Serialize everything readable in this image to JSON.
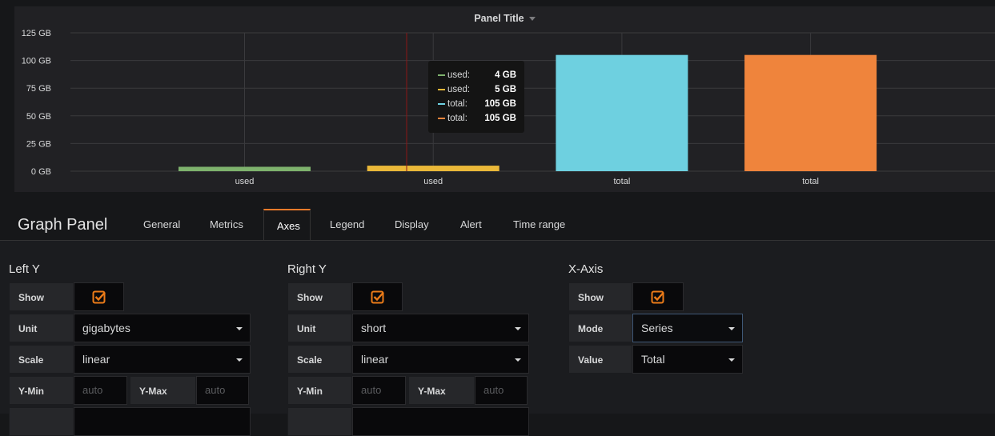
{
  "panel": {
    "title": "Panel Title"
  },
  "chart_data": {
    "type": "bar",
    "y_ticks": [
      "125 GB",
      "100 GB",
      "75 GB",
      "50 GB",
      "25 GB",
      "0 GB"
    ],
    "ylim": [
      0,
      125
    ],
    "categories": [
      "used",
      "used",
      "total",
      "total"
    ],
    "values": [
      4,
      5,
      105,
      105
    ],
    "colors": [
      "#7eb26d",
      "#eab839",
      "#6ed0e0",
      "#ef843c"
    ],
    "grid": true
  },
  "tooltip": {
    "rows": [
      {
        "name": "used:",
        "value": "4 GB",
        "color": "#7eb26d"
      },
      {
        "name": "used:",
        "value": "5 GB",
        "color": "#eab839"
      },
      {
        "name": "total:",
        "value": "105 GB",
        "color": "#6ed0e0"
      },
      {
        "name": "total:",
        "value": "105 GB",
        "color": "#ef843c"
      }
    ]
  },
  "editor": {
    "title": "Graph Panel",
    "tabs": [
      "General",
      "Metrics",
      "Axes",
      "Legend",
      "Display",
      "Alert",
      "Time range"
    ],
    "active_tab": "Axes"
  },
  "left_y": {
    "title": "Left Y",
    "show_label": "Show",
    "unit_label": "Unit",
    "unit_value": "gigabytes",
    "scale_label": "Scale",
    "scale_value": "linear",
    "ymin_label": "Y-Min",
    "ymin_placeholder": "auto",
    "ymax_label": "Y-Max",
    "ymax_placeholder": "auto"
  },
  "right_y": {
    "title": "Right Y",
    "show_label": "Show",
    "unit_label": "Unit",
    "unit_value": "short",
    "scale_label": "Scale",
    "scale_value": "linear",
    "ymin_label": "Y-Min",
    "ymin_placeholder": "auto",
    "ymax_label": "Y-Max",
    "ymax_placeholder": "auto"
  },
  "x_axis": {
    "title": "X-Axis",
    "show_label": "Show",
    "mode_label": "Mode",
    "mode_value": "Series",
    "value_label": "Value",
    "value_value": "Total"
  },
  "colors": {
    "accent": "#ee7a2a",
    "check": "#eb7b18"
  }
}
